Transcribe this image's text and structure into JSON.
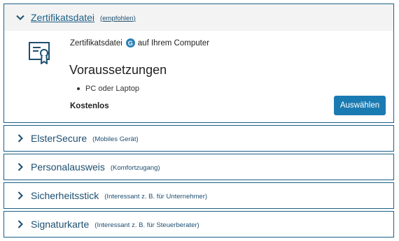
{
  "expanded": {
    "title": "Zertifikatsdatei",
    "subtitle": "(empfohlen)",
    "description_before": "Zertifikatsdatei",
    "badge": "G",
    "description_after": "auf Ihrem Computer",
    "requirements_title": "Voraussetzungen",
    "requirements": [
      "PC oder Laptop"
    ],
    "cost": "Kostenlos",
    "select_label": "Auswählen",
    "icon": "certificate-icon"
  },
  "options": [
    {
      "title": "ElsterSecure",
      "subtitle": "(Mobiles Gerät)"
    },
    {
      "title": "Personalausweis",
      "subtitle": "(Komfortzugang)"
    },
    {
      "title": "Sicherheitsstick",
      "subtitle": "(Interessant z. B. für Unternehmer)"
    },
    {
      "title": "Signaturkarte",
      "subtitle": "(Interessant z. B. für Steuerberater)"
    }
  ],
  "colors": {
    "accent": "#1a7bb2",
    "border": "#1b5f86",
    "link": "#1d4f70"
  }
}
